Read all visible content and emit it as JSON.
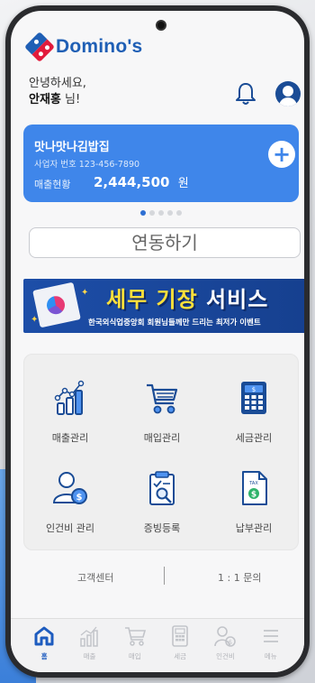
{
  "app": {
    "brand": "Domino's"
  },
  "header": {
    "greeting": "안녕하세요,",
    "user_name": "안재홍",
    "honorific": " 님!"
  },
  "business_card": {
    "business_name": "맛나맛나김밥집",
    "registration": "사업자 번호 123-456-7890",
    "sales_label": "매출현황",
    "sales_amount": "2,444,500",
    "currency": "원",
    "color": "#3f86ea"
  },
  "carousel": {
    "total_pages": 5,
    "current_page": 1
  },
  "link_button": {
    "label": "연동하기"
  },
  "banner": {
    "headline_part1": "세무 기장",
    "headline_part2": "서비스",
    "subtext": "한국외식업중앙회 회원님들께만 드리는 최저가 이벤트"
  },
  "menu": {
    "items": [
      {
        "label": "매출관리",
        "icon": "bar-chart-icon"
      },
      {
        "label": "매입관리",
        "icon": "shopping-cart-icon"
      },
      {
        "label": "세금관리",
        "icon": "calculator-icon"
      },
      {
        "label": "인건비 관리",
        "icon": "person-coin-icon"
      },
      {
        "label": "증빙등록",
        "icon": "clipboard-search-icon"
      },
      {
        "label": "납부관리",
        "icon": "tax-document-icon"
      }
    ]
  },
  "support": {
    "customer_center": "고객센터",
    "inquiry": "1 : 1 문의"
  },
  "tabbar": {
    "items": [
      {
        "label": "홈",
        "icon": "home-icon",
        "active": true
      },
      {
        "label": "매출",
        "icon": "bar-chart-icon",
        "active": false
      },
      {
        "label": "매입",
        "icon": "shopping-cart-icon",
        "active": false
      },
      {
        "label": "세금",
        "icon": "calculator-icon",
        "active": false
      },
      {
        "label": "인건비",
        "icon": "person-coin-icon",
        "active": false
      },
      {
        "label": "메뉴",
        "icon": "hamburger-menu-icon",
        "active": false
      }
    ]
  },
  "colors": {
    "brand_blue": "#1f5fb5",
    "brand_red": "#e21b3c",
    "accent": "#2e6fd3"
  }
}
